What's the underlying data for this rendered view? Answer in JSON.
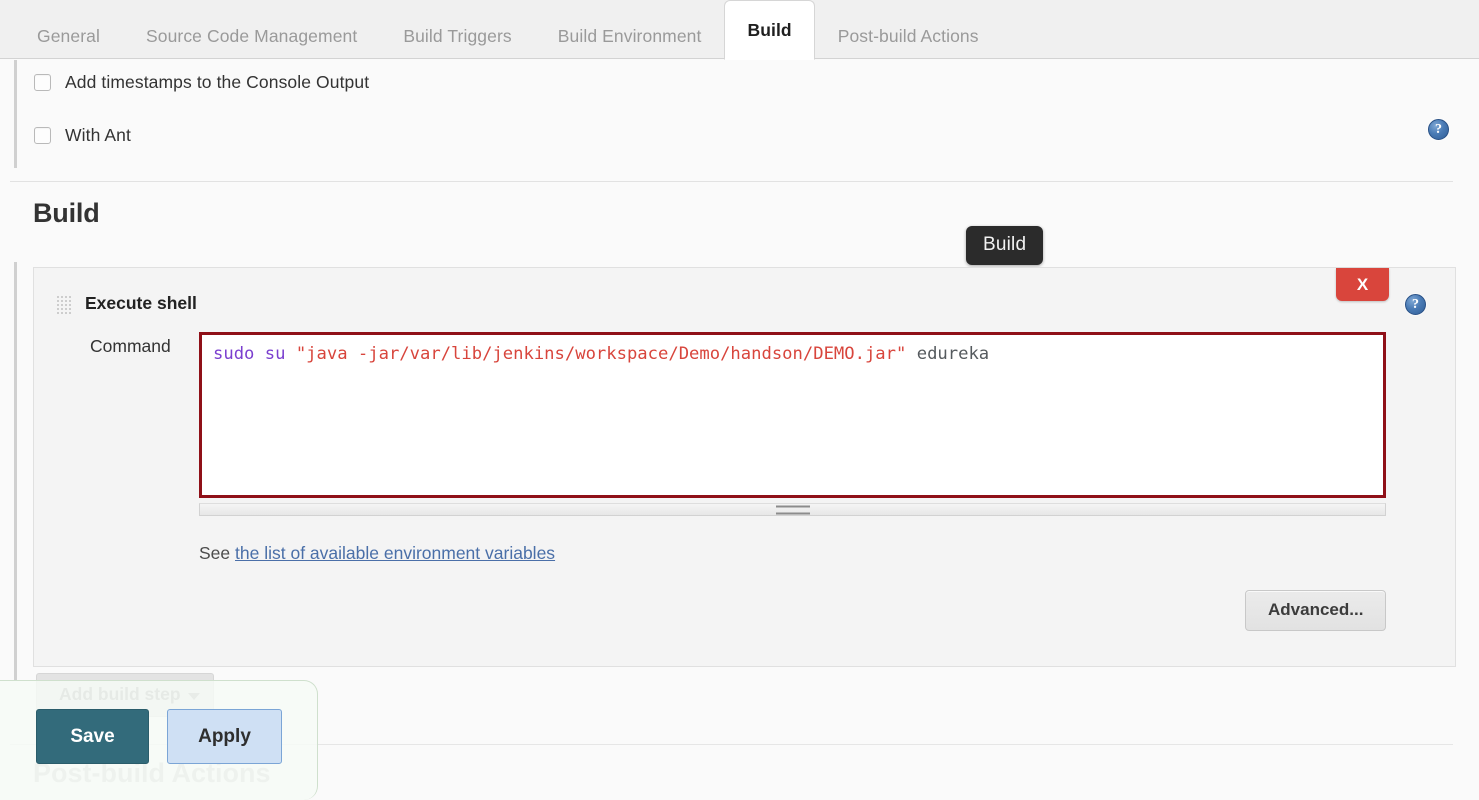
{
  "tabs": [
    {
      "label": "General",
      "active": false
    },
    {
      "label": "Source Code Management",
      "active": false
    },
    {
      "label": "Build Triggers",
      "active": false
    },
    {
      "label": "Build Environment",
      "active": false
    },
    {
      "label": "Build",
      "active": true
    },
    {
      "label": "Post-build Actions",
      "active": false
    }
  ],
  "build_environment": {
    "checkboxes": [
      {
        "label": "Add timestamps to the Console Output",
        "checked": false,
        "has_help": false
      },
      {
        "label": "With Ant",
        "checked": false,
        "has_help": true
      }
    ],
    "help_icon": "help-icon"
  },
  "build_section": {
    "title": "Build",
    "tooltip": "Build"
  },
  "build_step": {
    "title": "Execute shell",
    "grip_icon": "drag-handle-icon",
    "help_icon": "help-icon",
    "close_label": "X",
    "command_label": "Command",
    "command_tokens": [
      {
        "text": "sudo",
        "type": "cmd"
      },
      {
        "text": " ",
        "type": "plain"
      },
      {
        "text": "su",
        "type": "cmd"
      },
      {
        "text": " ",
        "type": "plain"
      },
      {
        "text": "\"java -jar/var/lib/jenkins/workspace/Demo/handson/DEMO.jar\"",
        "type": "str"
      },
      {
        "text": " ",
        "type": "plain"
      },
      {
        "text": "edureka",
        "type": "arg"
      }
    ],
    "command_value": "sudo su \"java -jar/var/lib/jenkins/workspace/Demo/handson/DEMO.jar\" edureka",
    "see_prefix": "See",
    "see_link": "the list of available environment variables",
    "advanced_label": "Advanced...",
    "resize_handle": "textarea-resize-handle"
  },
  "add_build_step": {
    "label": "Add build step",
    "caret_icon": "chevron-down-icon"
  },
  "post_build": {
    "title": "Post-build Actions"
  },
  "save_bar": {
    "save_label": "Save",
    "apply_label": "Apply"
  },
  "colors": {
    "active_tab_text": "#1f1f1f",
    "inactive_tab_text": "#9a9a9a",
    "textarea_border": "#8f1018",
    "close_button": "#d9453c",
    "save_button": "#336b7b",
    "apply_button": "#cfe0f4",
    "link": "#4a6fa8",
    "token_command": "#7b3fcf",
    "token_string": "#d8453c",
    "token_arg": "#555a5e"
  }
}
